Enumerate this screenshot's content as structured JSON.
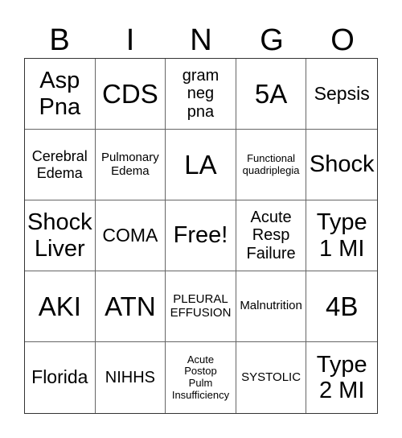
{
  "header": [
    "B",
    "I",
    "N",
    "G",
    "O"
  ],
  "cells": [
    {
      "text": "Asp\nPna",
      "size": "s-l"
    },
    {
      "text": "CDS",
      "size": "s-xl"
    },
    {
      "text": "gram\nneg\npna",
      "size": "s-ms"
    },
    {
      "text": "5A",
      "size": "s-xl"
    },
    {
      "text": "Sepsis",
      "size": "s-m"
    },
    {
      "text": "Cerebral\nEdema",
      "size": "s-s"
    },
    {
      "text": "Pulmonary\nEdema",
      "size": "s-xs"
    },
    {
      "text": "LA",
      "size": "s-xl"
    },
    {
      "text": "Functional\nquadriplegia",
      "size": "s-xxs"
    },
    {
      "text": "Shock",
      "size": "s-l"
    },
    {
      "text": "Shock\nLiver",
      "size": "s-l"
    },
    {
      "text": "COMA",
      "size": "s-m"
    },
    {
      "text": "Free!",
      "size": "s-l"
    },
    {
      "text": "Acute\nResp\nFailure",
      "size": "s-ms"
    },
    {
      "text": "Type\n1 MI",
      "size": "s-l"
    },
    {
      "text": "AKI",
      "size": "s-xl"
    },
    {
      "text": "ATN",
      "size": "s-xl"
    },
    {
      "text": "PLEURAL\nEFFUSION",
      "size": "s-xs"
    },
    {
      "text": "Malnutrition",
      "size": "s-xs"
    },
    {
      "text": "4B",
      "size": "s-xl"
    },
    {
      "text": "Florida",
      "size": "s-m"
    },
    {
      "text": "NIHHS",
      "size": "s-ms"
    },
    {
      "text": "Acute\nPostop\nPulm\nInsufficiency",
      "size": "s-xxs"
    },
    {
      "text": "SYSTOLIC",
      "size": "s-xs"
    },
    {
      "text": "Type\n2 MI",
      "size": "s-l"
    }
  ]
}
